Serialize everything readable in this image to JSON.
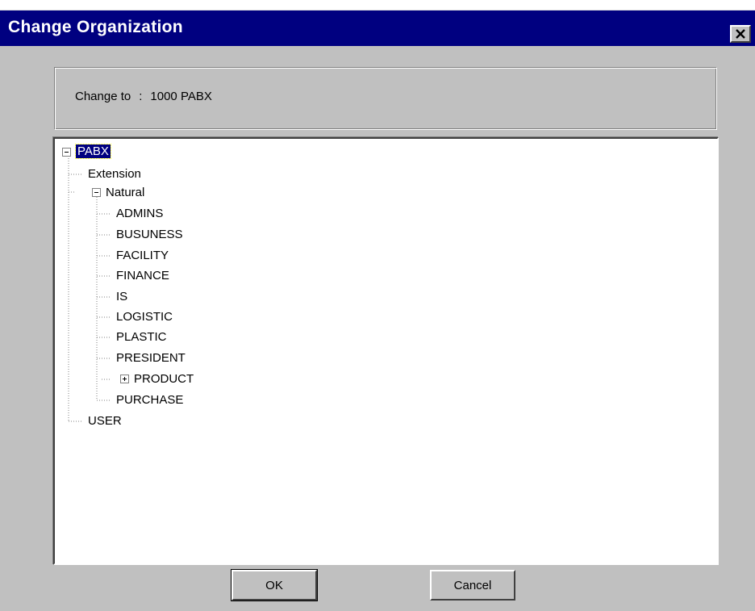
{
  "window": {
    "title": "Change Organization",
    "close_icon": "close-icon"
  },
  "info": {
    "label": "Change to",
    "separator": ":",
    "value": "1000 PABX"
  },
  "tree": {
    "root": {
      "label": "PABX",
      "expanded": true,
      "selected": true
    },
    "children": [
      {
        "label": "Extension"
      },
      {
        "label": "Natural",
        "expanded": true
      },
      {
        "label": "ADMINS"
      },
      {
        "label": "BUSUNESS"
      },
      {
        "label": "FACILITY"
      },
      {
        "label": "FINANCE"
      },
      {
        "label": "IS"
      },
      {
        "label": "LOGISTIC"
      },
      {
        "label": "PLASTIC"
      },
      {
        "label": "PRESIDENT"
      },
      {
        "label": "PRODUCT",
        "expanded": false
      },
      {
        "label": "PURCHASE"
      },
      {
        "label": "USER"
      }
    ]
  },
  "buttons": {
    "ok_label": "OK",
    "cancel_label": "Cancel"
  },
  "colors": {
    "titlebar": "#000080",
    "dialog": "#c0c0c0",
    "selection": "#000080"
  }
}
